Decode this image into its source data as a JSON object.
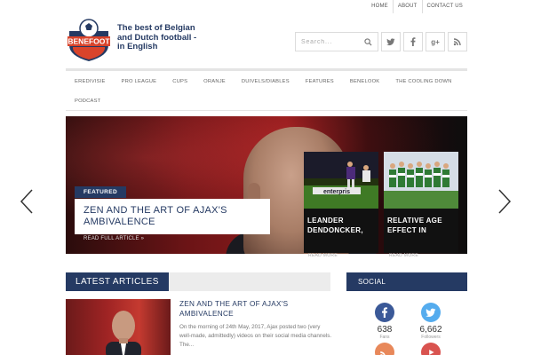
{
  "top_nav": {
    "items": [
      "HOME",
      "ABOUT",
      "CONTACT US"
    ]
  },
  "logo": {
    "badge_text": "BENEFOOT",
    "tagline": "The best of Belgian and Dutch football - in English"
  },
  "search": {
    "placeholder": "Search..."
  },
  "header_social": [
    "twitter-icon",
    "facebook-icon",
    "google-plus-icon",
    "rss-icon"
  ],
  "main_nav": {
    "row1": [
      "EREDIVISIE",
      "PRO LEAGUE",
      "CUPS",
      "ORANJE",
      "DUIVELS/DIABLES",
      "FEATURES",
      "BENELOOK",
      "THE COOLING DOWN"
    ],
    "row2": [
      "PODCAST"
    ]
  },
  "hero": {
    "tag": "FEATURED",
    "title": "ZEN AND THE ART OF AJAX'S AMBIVALENCE",
    "read_more": "READ FULL ARTICLE »"
  },
  "side_cards": [
    {
      "title": "LEANDER DENDONCKER,",
      "more": "READ MORE"
    },
    {
      "title": "RELATIVE AGE EFFECT IN",
      "more": "READ MORE"
    }
  ],
  "latest": {
    "heading": "LATEST ARTICLES",
    "article": {
      "title": "ZEN AND THE ART OF AJAX'S AMBIVALENCE",
      "excerpt": "On the morning of 24th May, 2017, Ajax posted two (very well-made, admittedly) videos on their social media channels. The..."
    }
  },
  "social": {
    "heading": "SOCIAL",
    "facebook": {
      "count": "638",
      "label": "Fans"
    },
    "twitter": {
      "count": "6,662",
      "label": "Followers"
    }
  },
  "colors": {
    "brand_navy": "#253a63",
    "facebook": "#3b5998",
    "twitter": "#55acee",
    "rss": "#e8885a",
    "youtube": "#d9534f"
  }
}
